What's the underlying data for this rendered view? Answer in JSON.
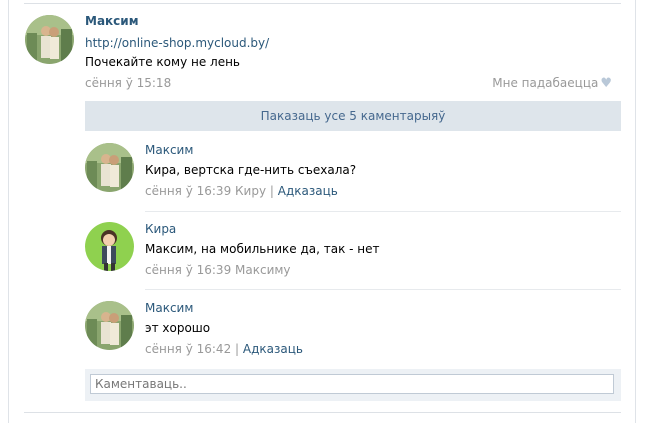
{
  "post": {
    "author": "Максим",
    "link": "http://online-shop.mycloud.by/",
    "text": "Почекайте кому не лень",
    "date": "сёння ў 15:18",
    "like_label": "Мне падабаецца"
  },
  "comments_block": {
    "show_all_label": "Паказаць усе 5 каментарыяў",
    "items": [
      {
        "author": "Максим",
        "text": "Кира, вертска где-нить съехала?",
        "date": "сёння ў 16:39",
        "to": "Киру",
        "separator": "|",
        "reply": "Адказаць"
      },
      {
        "author": "Кира",
        "text": "Максим, на мобильнике да, так - нет",
        "date": "сёння ў 16:39",
        "to": "Максиму"
      },
      {
        "author": "Максим",
        "text": "эт хорошо",
        "date": "сёння ў 16:42",
        "separator": "|",
        "reply": "Адказаць"
      }
    ],
    "reply_placeholder": "Каментаваць.."
  },
  "icons": {
    "like": "heart-icon"
  },
  "colors": {
    "link": "#2b587a",
    "meta": "#999999",
    "show_all_bg": "#dee5eb",
    "reply_bg": "#edf1f5"
  }
}
